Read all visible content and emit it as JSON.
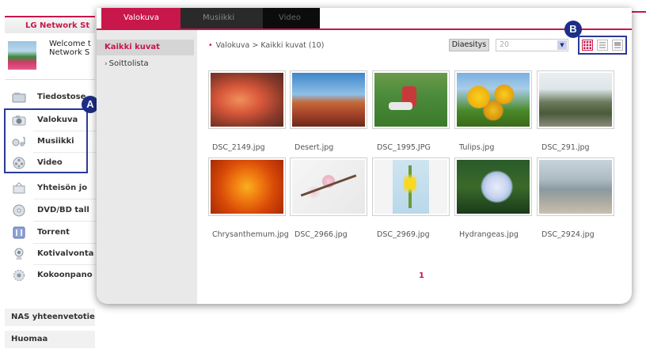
{
  "app": {
    "brand": "LG Network St",
    "welcome": [
      "Welcome t",
      "Network S"
    ],
    "menu": [
      {
        "label": "Tiedostose",
        "icon": "file-explorer-icon"
      },
      {
        "label": "Valokuva",
        "icon": "camera-icon"
      },
      {
        "label": "Musiikki",
        "icon": "music-icon"
      },
      {
        "label": "Video",
        "icon": "film-reel-icon"
      },
      {
        "label": "Yhteisön jo",
        "icon": "share-icon"
      },
      {
        "label": "DVD/BD tall",
        "icon": "disc-icon"
      },
      {
        "label": "Torrent",
        "icon": "torrent-icon"
      },
      {
        "label": "Kotivalvonta",
        "icon": "webcam-icon"
      },
      {
        "label": "Kokoonpano",
        "icon": "settings-gear-icon"
      }
    ],
    "bottom_items": [
      "NAS yhteenvetotied",
      "Huomaa"
    ]
  },
  "markers": {
    "a": "A",
    "b": "B"
  },
  "panel": {
    "tabs": [
      "Valokuva",
      "Musiikki",
      "Video"
    ],
    "side_nav": {
      "all_photos": "Kaikki kuvat",
      "playlist": "Soittolista"
    },
    "breadcrumb": "Valokuva > Kaikki kuvat (10)",
    "slideshow_label": "Diaesitys",
    "interval_value": "20",
    "view_modes": [
      "grid-view-icon",
      "list-view-icon",
      "detail-view-icon"
    ],
    "photos": [
      {
        "name": "DSC_2149.jpg",
        "subject": "shrimp"
      },
      {
        "name": "Desert.jpg",
        "subject": "desert"
      },
      {
        "name": "DSC_1995.JPG",
        "subject": "soccer"
      },
      {
        "name": "Tulips.jpg",
        "subject": "tulips"
      },
      {
        "name": "DSC_291.jpg",
        "subject": "hillside"
      },
      {
        "name": "Chrysanthemum.jpg",
        "subject": "chrysanthemum"
      },
      {
        "name": "DSC_2966.jpg",
        "subject": "blossom"
      },
      {
        "name": "DSC_2969.jpg",
        "subject": "yellow-flower"
      },
      {
        "name": "Hydrangeas.jpg",
        "subject": "hydrangeas"
      },
      {
        "name": "DSC_2924.jpg",
        "subject": "cityscape"
      }
    ],
    "page": "1"
  },
  "colors": {
    "accent": "#c8174a",
    "marker": "#1c2e86"
  }
}
